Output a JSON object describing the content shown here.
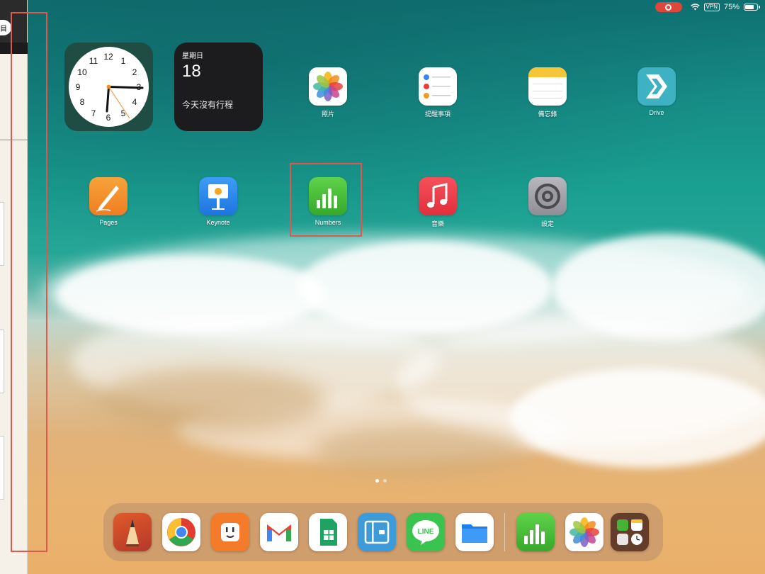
{
  "status_bar": {
    "battery_percent": "75%",
    "vpn_label": "VPN",
    "battery_level": 0.75
  },
  "side_panel": {
    "badge_text": "目"
  },
  "widgets": {
    "clock": {
      "numbers": [
        "12",
        "1",
        "2",
        "3",
        "4",
        "5",
        "6",
        "7",
        "8",
        "9",
        "10",
        "11"
      ]
    },
    "calendar": {
      "weekday": "星期日",
      "date": "18",
      "empty_text": "今天沒有行程"
    }
  },
  "apps": [
    {
      "label": "照片"
    },
    {
      "label": "提醒事項"
    },
    {
      "label": "備忘錄"
    },
    {
      "label": "Drive"
    },
    {
      "label": "Pages"
    },
    {
      "label": "Keynote"
    },
    {
      "label": "Numbers"
    },
    {
      "label": "音樂"
    },
    {
      "label": "設定"
    }
  ],
  "dock": {
    "icons": [
      "pencil-app-icon",
      "chrome-icon",
      "plug-app-icon",
      "gmail-icon",
      "google-sheets-icon",
      "wallet-app-icon",
      "line-icon",
      "files-icon",
      "numbers-icon",
      "photos-icon",
      "app-library-icon"
    ],
    "line_text": "LINE"
  },
  "colors": {
    "highlight": "#e0584d",
    "numbers_green": "#46b336"
  }
}
